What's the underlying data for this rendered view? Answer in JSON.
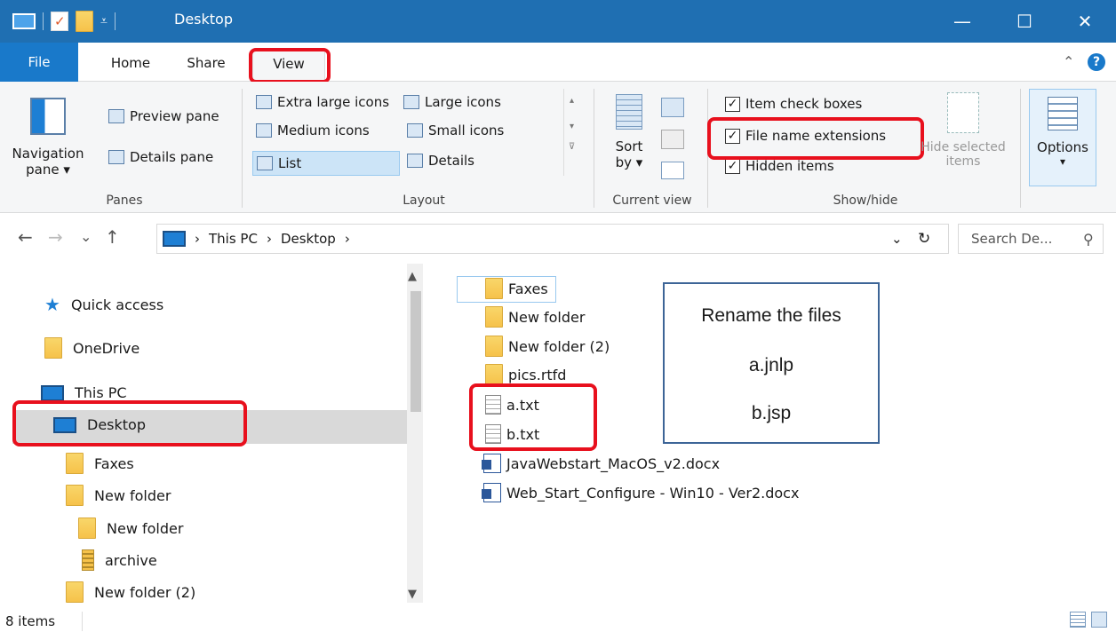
{
  "window": {
    "title": "Desktop",
    "minimize_glyph": "—",
    "maximize_glyph": "☐",
    "close_glyph": "✕"
  },
  "ribbon_tabs": [
    "File",
    "Home",
    "Share",
    "View"
  ],
  "ribbon": {
    "panes": {
      "navigation_pane_label": "Navigation",
      "navigation_pane_sub": "pane ▾",
      "preview_pane": "Preview pane",
      "details_pane": "Details pane",
      "group": "Panes"
    },
    "layout": {
      "items": [
        "Extra large icons",
        "Large icons",
        "Medium icons",
        "Small icons",
        "List",
        "Details"
      ],
      "selected": "List",
      "group": "Layout"
    },
    "current_view": {
      "sort_label": "Sort",
      "sort_sub": "by ▾",
      "group": "Current view"
    },
    "show_hide": {
      "item_check_boxes": "Item check boxes",
      "file_name_extensions": "File name extensions",
      "hidden_items": "Hidden items",
      "hide_selected_1": "Hide selected",
      "hide_selected_2": "items",
      "group": "Show/hide"
    },
    "options": {
      "label": "Options",
      "sub": "▾"
    }
  },
  "navigation": {
    "back": "←",
    "forward": "→",
    "recent": "⌄",
    "up": "↑",
    "breadcrumb": [
      "This PC",
      "Desktop"
    ],
    "separator": "›",
    "dropdown": "⌄",
    "refresh": "↻",
    "search_placeholder": "Search De...",
    "search_glyph": "⚲"
  },
  "nav_pane": {
    "items": [
      "Quick access",
      "OneDrive",
      "This PC",
      "Desktop",
      "Faxes",
      "New folder",
      "New folder",
      "archive",
      "New folder (2)"
    ],
    "selected": "Desktop"
  },
  "files": [
    "Faxes",
    "New folder",
    "New folder (2)",
    "pics.rtfd",
    "a.txt",
    "b.txt",
    "JavaWebstart_MacOS_v2.docx",
    "Web_Start_Configure - Win10 - Ver2.docx"
  ],
  "callout": {
    "line1": "Rename the files",
    "line2": "a.jnlp",
    "line3": "b.jsp"
  },
  "status": {
    "item_count": "8 items"
  },
  "colors": {
    "titlebar": "#1f6fb2",
    "file_tab": "#1979ca",
    "highlight": "#e8101d",
    "selection": "#cce4f7"
  }
}
